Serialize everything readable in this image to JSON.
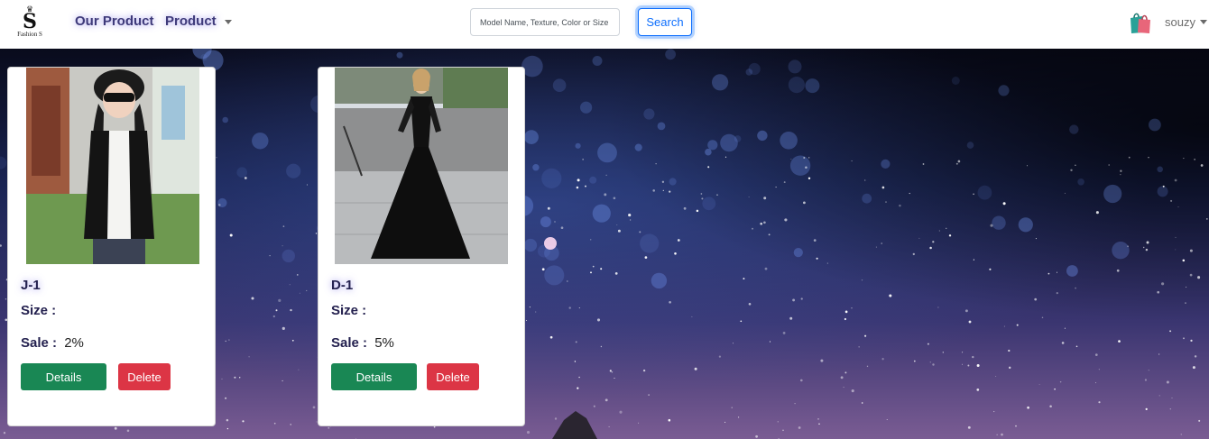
{
  "brand": {
    "mark": "S",
    "text": "Fashion S",
    "crown": "♛"
  },
  "nav": {
    "our_product": "Our Product",
    "product": "Product"
  },
  "search": {
    "placeholder": "Model Name, Texture, Color or Size",
    "button": "Search"
  },
  "user": {
    "name": "souzy",
    "bag_icon": "shopping-bag-icon"
  },
  "products": [
    {
      "code": "J-1",
      "size_label": "Size :",
      "sale_label": "Sale :",
      "sale_value": "2%",
      "details": "Details",
      "delete": "Delete"
    },
    {
      "code": "D-1",
      "size_label": "Size :",
      "sale_label": "Sale :",
      "sale_value": "5%",
      "details": "Details",
      "delete": "Delete"
    }
  ],
  "colors": {
    "success": "#198754",
    "danger": "#dc3545",
    "primary": "#0d6efd",
    "nav_text": "#3e3a7a"
  }
}
